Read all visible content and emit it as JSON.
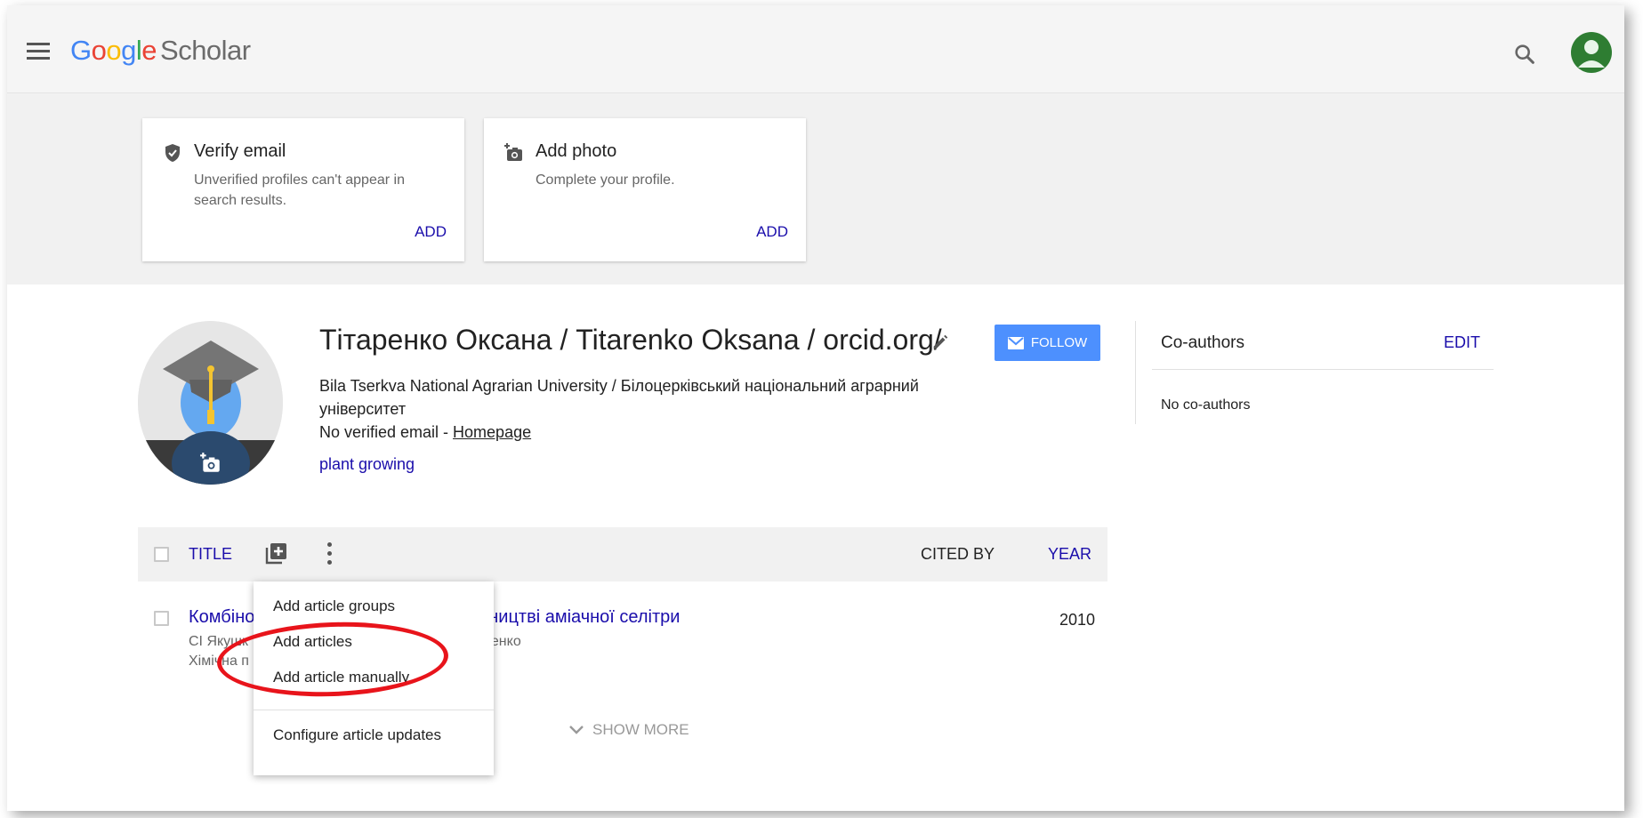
{
  "header": {
    "logo_letters": [
      "G",
      "o",
      "o",
      "g",
      "l",
      "e"
    ],
    "logo_product": "Scholar"
  },
  "notices": [
    {
      "title": "Verify email",
      "text": "Unverified profiles can't appear in search results.",
      "action": "ADD",
      "icon": "verified-shield-icon"
    },
    {
      "title": "Add photo",
      "text": "Complete your profile.",
      "action": "ADD",
      "icon": "add-photo-icon"
    }
  ],
  "profile": {
    "name": "Тітаренко Оксана / Titarenko Oksana / orcid.org/",
    "follow_label": "FOLLOW",
    "affiliation": "Bila Tserkva National Agrarian University / Білоцерківський національний аграрний університет",
    "email_text": "No verified email - ",
    "homepage_label": "Homepage",
    "interest": "plant growing"
  },
  "coauthors": {
    "title": "Co-authors",
    "edit_label": "EDIT",
    "empty_text": "No co-authors"
  },
  "table": {
    "col_title": "TITLE",
    "col_cited": "CITED BY",
    "col_year": "YEAR",
    "rows": [
      {
        "title": "Комбіно",
        "title_tail": "иробництві аміачної селітри",
        "authors": "СІ Якушк",
        "authors_tail": "итаренко",
        "venue": "Хімічна п",
        "year": "2010"
      }
    ],
    "show_more": "SHOW MORE"
  },
  "menu": {
    "items": [
      "Add article groups",
      "Add articles",
      "Add article manually"
    ],
    "footer_item": "Configure article updates"
  },
  "colors": {
    "link": "#1a0dab",
    "follow": "#4d90fe",
    "highlight": "#e8141b"
  }
}
